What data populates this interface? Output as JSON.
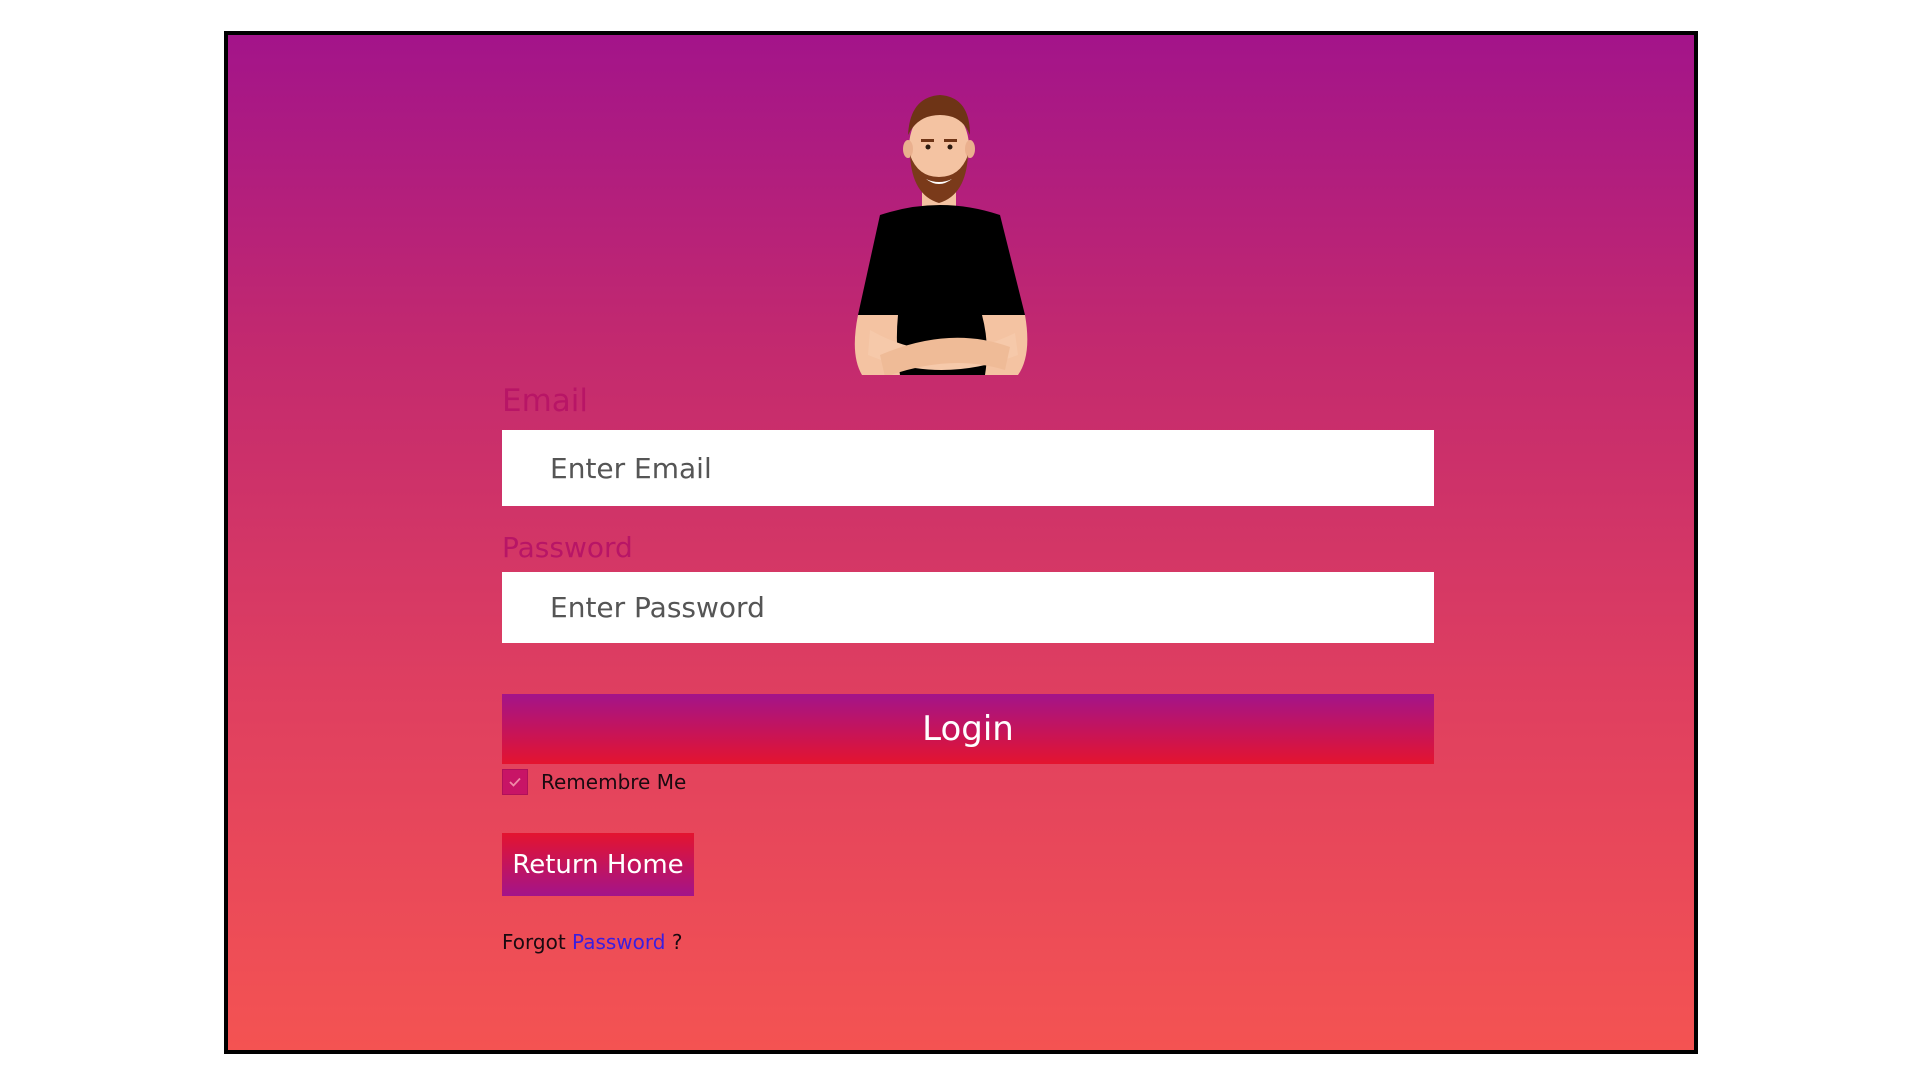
{
  "form": {
    "email_label": "Email",
    "email_placeholder": "Enter Email",
    "email_value": "",
    "password_label": "Password",
    "password_placeholder": "Enter Password",
    "password_value": "",
    "login_label": "Login",
    "remember_label": "Remembre Me",
    "remember_checked": true,
    "return_home_label": "Return Home",
    "forgot_prefix": "Forgot",
    "forgot_link": "Password",
    "forgot_suffix": "?"
  },
  "avatar": {
    "icon": "user-avatar-illustration"
  },
  "colors": {
    "background_top": "#a3148a",
    "background_bottom": "#f45352",
    "label": "#b81566",
    "link": "#3a1ee0",
    "button_top": "#a3148a",
    "button_bottom": "#e4142f"
  }
}
